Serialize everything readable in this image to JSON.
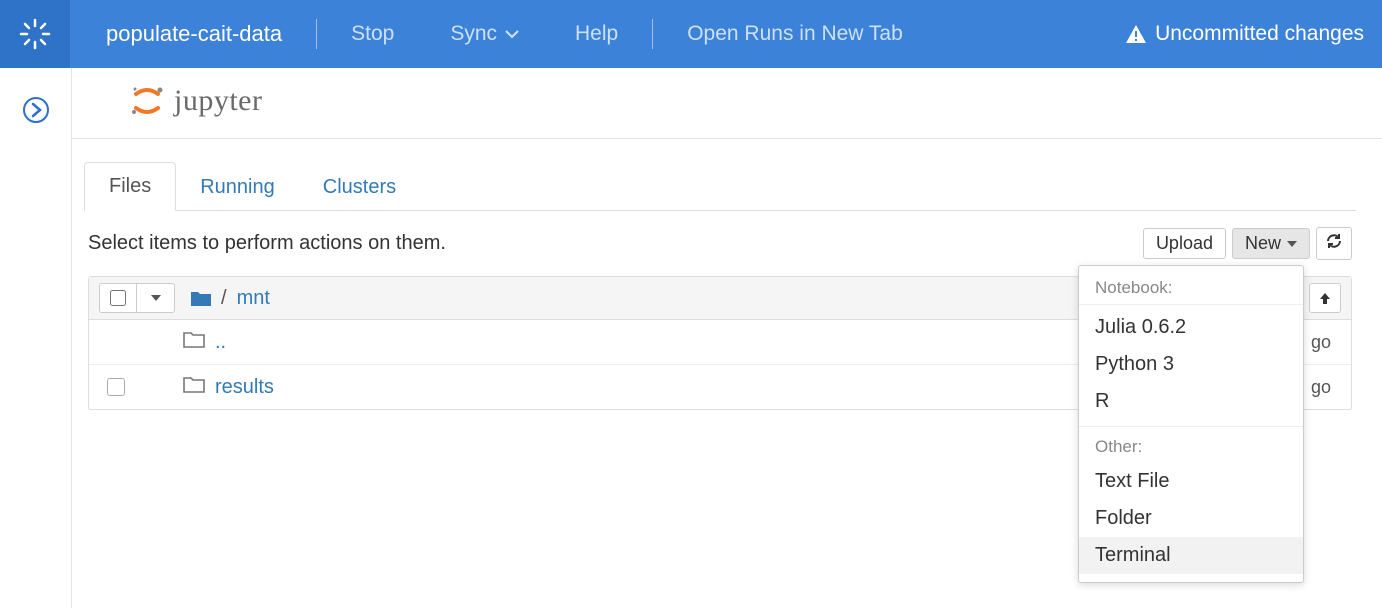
{
  "topbar": {
    "project": "populate-cait-data",
    "stop": "Stop",
    "sync": "Sync",
    "help": "Help",
    "open_runs": "Open Runs in New Tab",
    "uncommitted": "Uncommitted changes"
  },
  "brand": "jupyter",
  "tabs": {
    "files": "Files",
    "running": "Running",
    "clusters": "Clusters"
  },
  "hint": "Select items to perform actions on them.",
  "buttons": {
    "upload": "Upload",
    "new": "New"
  },
  "breadcrumb": {
    "sep": "/",
    "current": "mnt"
  },
  "rows": [
    {
      "name": "..",
      "time": "go"
    },
    {
      "name": "results",
      "time": "go"
    }
  ],
  "menu": {
    "notebook_header": "Notebook:",
    "kernels": [
      "Julia 0.6.2",
      "Python 3",
      "R"
    ],
    "other_header": "Other:",
    "other": [
      "Text File",
      "Folder",
      "Terminal"
    ]
  }
}
